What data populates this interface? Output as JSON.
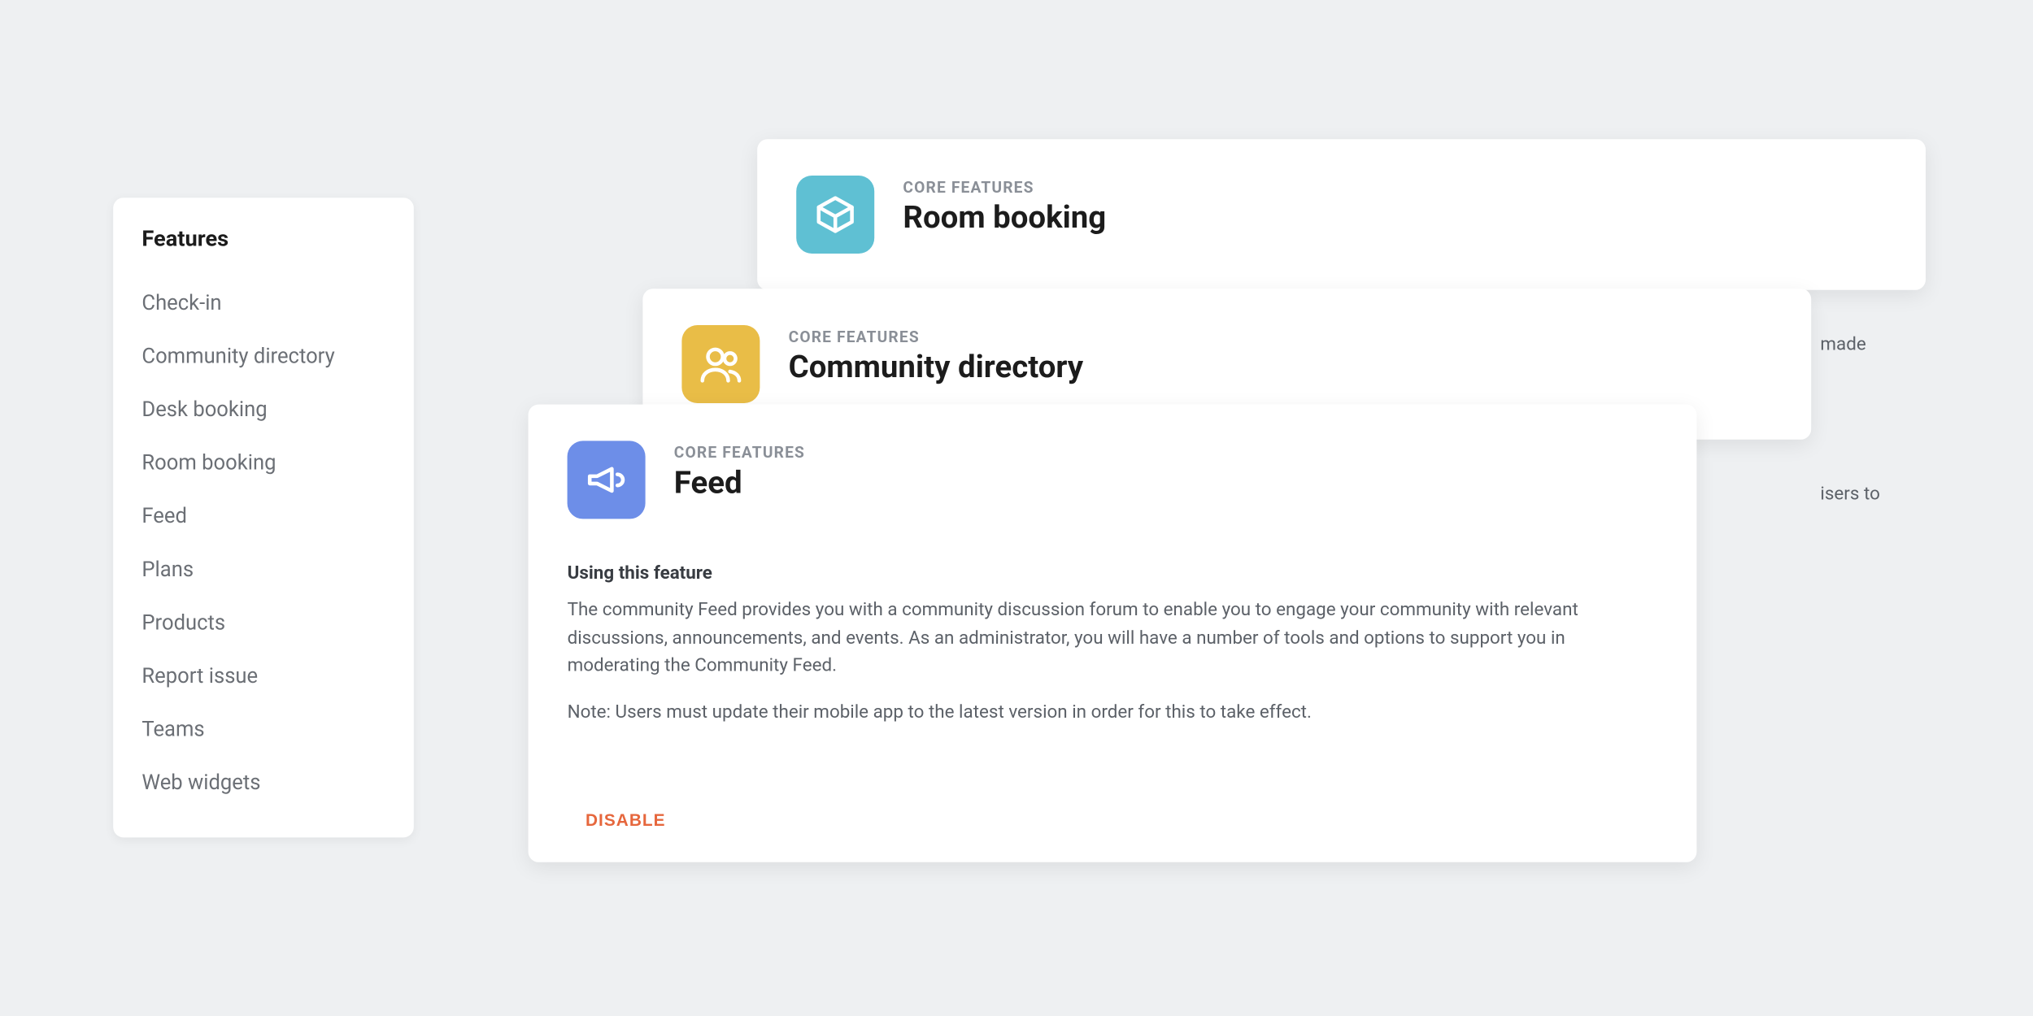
{
  "sidebar": {
    "title": "Features",
    "items": [
      "Check-in",
      "Community directory",
      "Desk booking",
      "Room booking",
      "Feed",
      "Plans",
      "Products",
      "Report issue",
      "Teams",
      "Web widgets"
    ]
  },
  "cards": {
    "back": {
      "eyebrow": "CORE FEATURES",
      "title": "Room booking"
    },
    "mid": {
      "eyebrow": "CORE FEATURES",
      "title": "Community directory"
    },
    "front": {
      "eyebrow": "CORE FEATURES",
      "title": "Feed",
      "section_head": "Using this feature",
      "body": "The community Feed provides you with a community discussion forum to enable you to engage your community with relevant discussions, announcements, and events. As an administrator, you will have a number of tools and options to support you in moderating the Community Feed.",
      "note": "Note: Users must update their mobile app to the latest version in order for this to take effect.",
      "disable_label": "DISABLE"
    }
  },
  "peek": {
    "made": "made",
    "users": "isers to"
  },
  "colors": {
    "teal": "#5fc0d3",
    "gold": "#e9bd47",
    "blue": "#6d8ee8",
    "accent": "#e6673d"
  }
}
